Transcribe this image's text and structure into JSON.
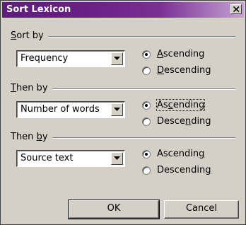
{
  "window": {
    "title": "Sort Lexicon",
    "close_label": "Close"
  },
  "groups": [
    {
      "label_pre": "",
      "label_key": "S",
      "label_post": "ort by",
      "select_value": "Frequency",
      "selected": "ascending",
      "asc": {
        "pre": "",
        "key": "A",
        "post": "scending"
      },
      "desc": {
        "pre": "",
        "key": "D",
        "post": "escending"
      }
    },
    {
      "label_pre": "",
      "label_key": "T",
      "label_post": "hen by",
      "select_value": "Number of words",
      "selected": "ascending",
      "asc": {
        "pre": "As",
        "key": "c",
        "post": "ending"
      },
      "desc": {
        "pre": "Desce",
        "key": "n",
        "post": "ding"
      }
    },
    {
      "label_pre": "Then ",
      "label_key": "b",
      "label_post": "y",
      "select_value": "Source text",
      "selected": "ascending",
      "asc": {
        "pre": "Ascendin",
        "key": "g",
        "post": ""
      },
      "desc": {
        "pre": "Descendin",
        "key": "g",
        "post": ""
      }
    }
  ],
  "buttons": {
    "ok": "OK",
    "cancel": "Cancel"
  },
  "colors": {
    "title_start": "#5c1e7a",
    "title_end": "#c4a3d2",
    "face": "#d4d0c8"
  }
}
